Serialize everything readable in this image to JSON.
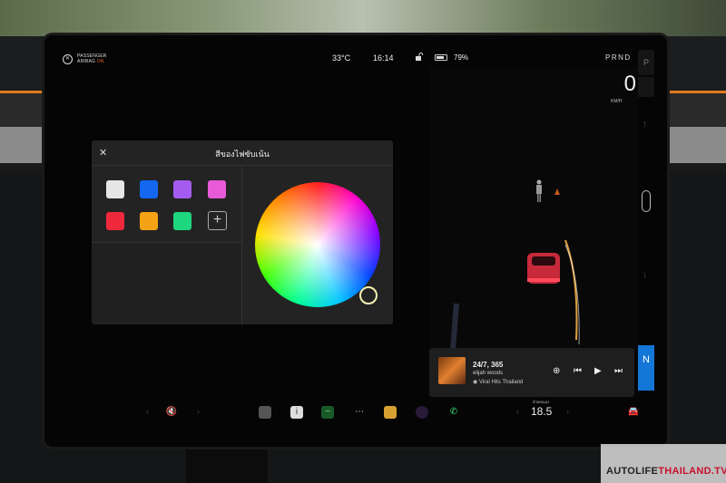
{
  "status": {
    "airbag_line1": "PASSENGER",
    "airbag_line2": "AIRBAG",
    "airbag_state": "ON",
    "temperature": "33°C",
    "time": "16:14",
    "battery_percent": "79%",
    "battery_level": 0.79
  },
  "dialog": {
    "title": "สีของไฟซับเน้น",
    "close_icon": "close-icon",
    "add_label": "+",
    "swatches": [
      "#e6e6e6",
      "#1467f0",
      "#a45cf0",
      "#e85ad8",
      "#f0283c",
      "#f4a316",
      "#1dd67e"
    ]
  },
  "drive": {
    "gears": "PRND",
    "speed": "0",
    "speed_unit": "KM/H",
    "gear_p": "P",
    "gear_n": "N"
  },
  "music": {
    "song": "24/7, 365",
    "artist": "elijah woods",
    "playlist": "Viral Hits Thailand"
  },
  "climate": {
    "label": "ด้วยตนเอง",
    "temperature": "18.5"
  },
  "watermark": {
    "brand_a": "AUTOLIFE",
    "brand_b": "THAILAND.TV"
  }
}
